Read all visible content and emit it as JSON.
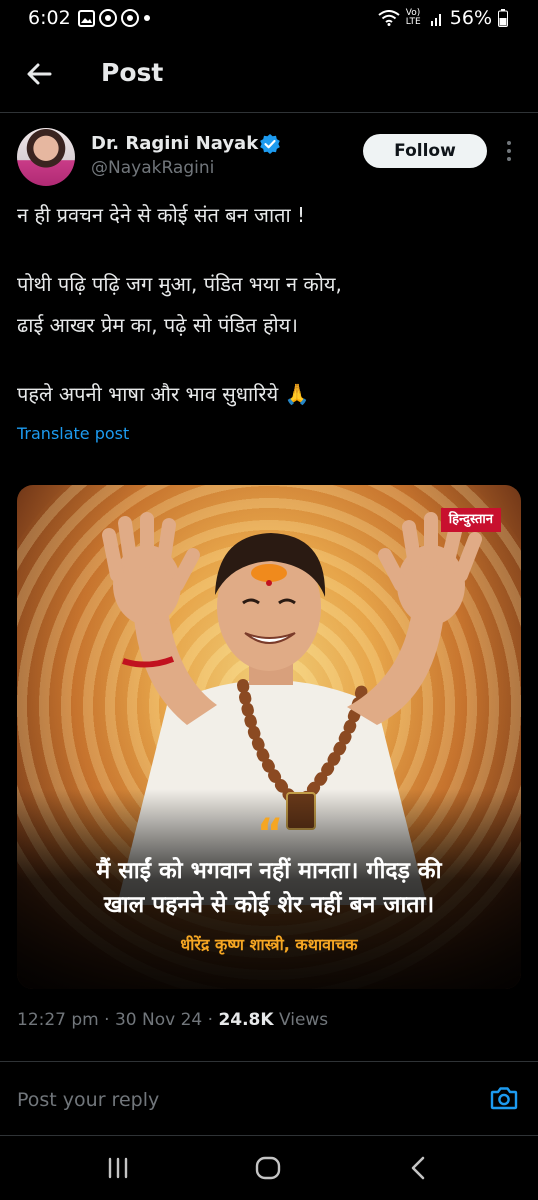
{
  "status_bar": {
    "time": "6:02",
    "left_icons": [
      "gallery-icon",
      "app-icon",
      "app-icon",
      "dot-icon"
    ],
    "battery": "56%",
    "network": "Vo) LTE"
  },
  "header": {
    "title": "Post"
  },
  "author": {
    "name": "Dr. Ragini Nayak",
    "handle": "@NayakRagini",
    "follow_label": "Follow"
  },
  "post": {
    "lines": [
      "न ही प्रवचन देने से कोई संत बन जाता !",
      "पोथी पढ़ि पढ़ि जग मुआ, पंडित भया न कोय,",
      "ढाई आखर प्रेम का, पढ़े सो पंडित होय।",
      "पहले अपनी भाषा और भाव सुधारिये 🙏"
    ],
    "translate_label": "Translate post"
  },
  "media": {
    "badge": "हिन्दुस्तान",
    "quote_mark": "“",
    "quote_lines": [
      "मैं साईं को भगवान नहीं मानता। गीदड़ की",
      "खाल पहनने से कोई शेर नहीं बन जाता।"
    ],
    "quote_author": "धीरेंद्र कृष्ण शास्त्री, कथावाचक"
  },
  "meta": {
    "time": "12:27 pm",
    "date": "30 Nov 24",
    "views_count": "24.8K",
    "views_label": "Views"
  },
  "reply": {
    "placeholder": "Post your reply"
  },
  "colors": {
    "accent": "#1d9bf0",
    "quote_accent": "#f5a623",
    "badge_red": "#c8102e"
  }
}
